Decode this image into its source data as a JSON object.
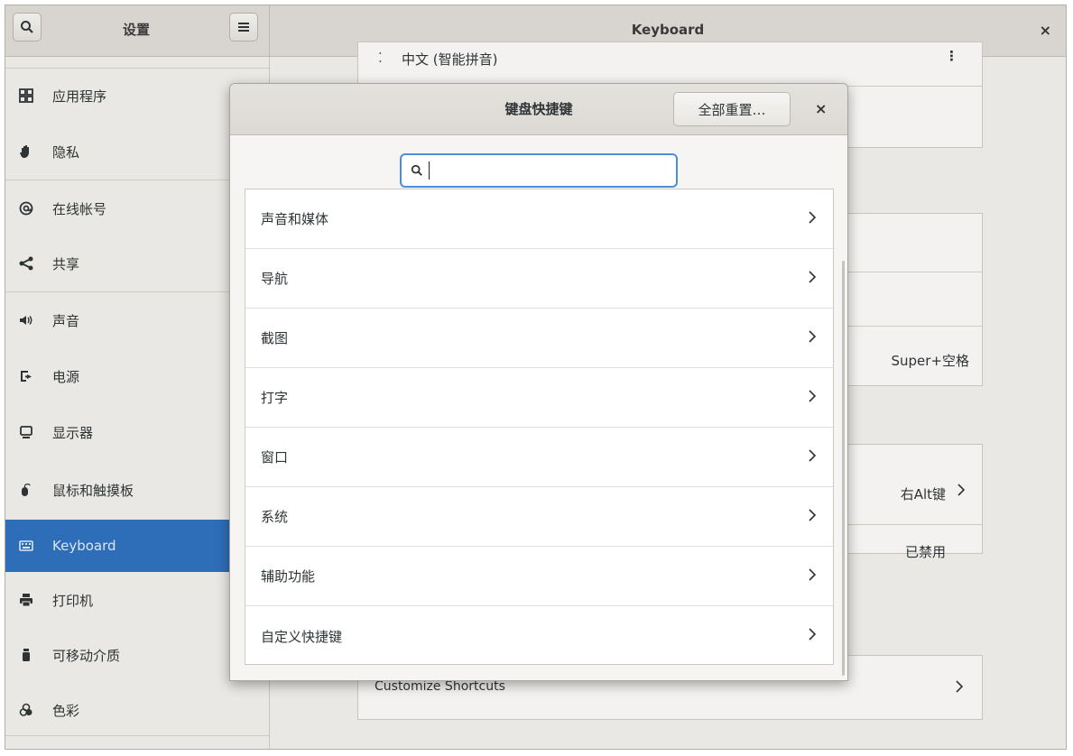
{
  "header": {
    "sidebar_title": "设置",
    "panel_title": "Keyboard",
    "close_glyph": "×"
  },
  "sidebar": {
    "items": [
      {
        "label": "应用程序",
        "icon": "apps-grid-icon"
      },
      {
        "label": "隐私",
        "icon": "hand-privacy-icon"
      },
      {
        "label": "在线帐号",
        "icon": "at-sign-icon"
      },
      {
        "label": "共享",
        "icon": "share-icon"
      },
      {
        "label": "声音",
        "icon": "speaker-icon"
      },
      {
        "label": "电源",
        "icon": "power-plug-icon"
      },
      {
        "label": "显示器",
        "icon": "display-icon"
      },
      {
        "label": "鼠标和触摸板",
        "icon": "mouse-icon"
      },
      {
        "label": "Keyboard",
        "icon": "keyboard-icon",
        "active": true
      },
      {
        "label": "打印机",
        "icon": "printer-icon"
      },
      {
        "label": "可移动介质",
        "icon": "usb-drive-icon"
      },
      {
        "label": "色彩",
        "icon": "color-icon"
      }
    ]
  },
  "background": {
    "input_source": "中文 (智能拼音)",
    "switch_shortcut": "Super+空格",
    "alt_key": "右Alt键",
    "compose_key": "已禁用",
    "customize_shortcuts": "Customize Shortcuts"
  },
  "dialog": {
    "title": "键盘快捷键",
    "reset_label": "全部重置…",
    "close_glyph": "×",
    "search": {
      "value": ""
    },
    "categories": [
      "声音和媒体",
      "导航",
      "截图",
      "打字",
      "窗口",
      "系统",
      "辅助功能",
      "自定义快捷键"
    ]
  },
  "colors": {
    "accent": "#2e6db8",
    "search_focus": "#4a90d9"
  }
}
